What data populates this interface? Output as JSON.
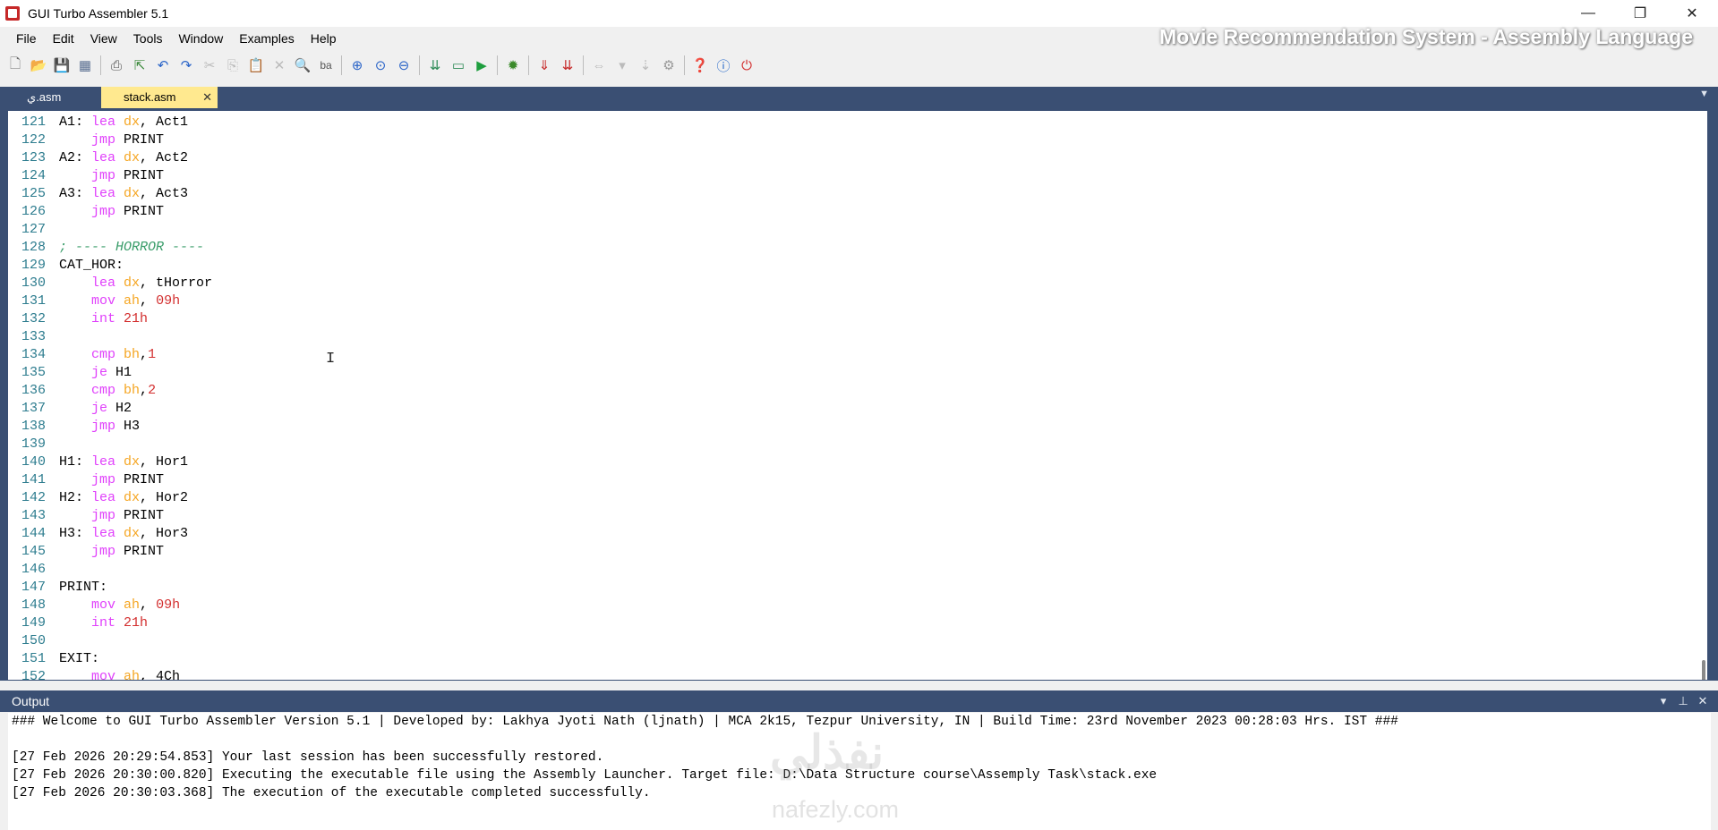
{
  "window": {
    "title": "GUI Turbo Assembler 5.1",
    "controls": {
      "minimize": "—",
      "restore": "❐",
      "close": "✕"
    }
  },
  "menu": {
    "items": [
      "File",
      "Edit",
      "View",
      "Tools",
      "Window",
      "Examples",
      "Help"
    ]
  },
  "overlay_caption": "Movie Recommendation System - Assembly Language",
  "toolbar": {
    "icons": [
      "new-file-icon",
      "open-folder-icon",
      "save-icon",
      "save-all-icon",
      "print-icon",
      "export-icon",
      "undo-icon",
      "redo-icon",
      "cut-icon",
      "copy-icon",
      "paste-icon",
      "delete-icon",
      "find-icon",
      "replace-icon",
      "zoom-in-icon",
      "zoom-reset-icon",
      "zoom-out-icon",
      "assemble-icon",
      "link-icon",
      "run-icon",
      "debug-icon",
      "download-icon",
      "settings-icon",
      "nav-back-icon",
      "filter-icon",
      "pin-icon",
      "gear-icon",
      "help-icon",
      "info-icon",
      "power-icon"
    ]
  },
  "tabs": [
    {
      "label": "ي.asm",
      "active": false
    },
    {
      "label": "stack.asm",
      "active": true,
      "close": "✕"
    }
  ],
  "editor": {
    "lines": [
      {
        "n": "121",
        "tokens": [
          [
            "plain",
            "A1: "
          ],
          [
            "kw",
            "lea "
          ],
          [
            "reg",
            "dx"
          ],
          [
            "plain",
            ", Act1"
          ]
        ]
      },
      {
        "n": "122",
        "tokens": [
          [
            "plain",
            "    "
          ],
          [
            "kw",
            "jmp "
          ],
          [
            "plain",
            "PRINT"
          ]
        ]
      },
      {
        "n": "123",
        "tokens": [
          [
            "plain",
            "A2: "
          ],
          [
            "kw",
            "lea "
          ],
          [
            "reg",
            "dx"
          ],
          [
            "plain",
            ", Act2"
          ]
        ]
      },
      {
        "n": "124",
        "tokens": [
          [
            "plain",
            "    "
          ],
          [
            "kw",
            "jmp "
          ],
          [
            "plain",
            "PRINT"
          ]
        ]
      },
      {
        "n": "125",
        "tokens": [
          [
            "plain",
            "A3: "
          ],
          [
            "kw",
            "lea "
          ],
          [
            "reg",
            "dx"
          ],
          [
            "plain",
            ", Act3"
          ]
        ]
      },
      {
        "n": "126",
        "tokens": [
          [
            "plain",
            "    "
          ],
          [
            "kw",
            "jmp "
          ],
          [
            "plain",
            "PRINT"
          ]
        ]
      },
      {
        "n": "127",
        "tokens": []
      },
      {
        "n": "128",
        "tokens": [
          [
            "cmt",
            "; ---- HORROR ----"
          ]
        ]
      },
      {
        "n": "129",
        "tokens": [
          [
            "plain",
            "CAT_HOR:"
          ]
        ]
      },
      {
        "n": "130",
        "tokens": [
          [
            "plain",
            "    "
          ],
          [
            "kw",
            "lea "
          ],
          [
            "reg",
            "dx"
          ],
          [
            "plain",
            ", tHorror"
          ]
        ]
      },
      {
        "n": "131",
        "tokens": [
          [
            "plain",
            "    "
          ],
          [
            "kw",
            "mov "
          ],
          [
            "reg",
            "ah"
          ],
          [
            "plain",
            ", "
          ],
          [
            "num",
            "09h"
          ]
        ]
      },
      {
        "n": "132",
        "tokens": [
          [
            "plain",
            "    "
          ],
          [
            "kw",
            "int "
          ],
          [
            "num",
            "21h"
          ]
        ]
      },
      {
        "n": "133",
        "tokens": []
      },
      {
        "n": "134",
        "tokens": [
          [
            "plain",
            "    "
          ],
          [
            "kw",
            "cmp "
          ],
          [
            "reg",
            "bh"
          ],
          [
            "plain",
            ","
          ],
          [
            "num",
            "1"
          ]
        ]
      },
      {
        "n": "135",
        "tokens": [
          [
            "plain",
            "    "
          ],
          [
            "kw",
            "je "
          ],
          [
            "plain",
            "H1"
          ]
        ]
      },
      {
        "n": "136",
        "tokens": [
          [
            "plain",
            "    "
          ],
          [
            "kw",
            "cmp "
          ],
          [
            "reg",
            "bh"
          ],
          [
            "plain",
            ","
          ],
          [
            "num",
            "2"
          ]
        ]
      },
      {
        "n": "137",
        "tokens": [
          [
            "plain",
            "    "
          ],
          [
            "kw",
            "je "
          ],
          [
            "plain",
            "H2"
          ]
        ]
      },
      {
        "n": "138",
        "tokens": [
          [
            "plain",
            "    "
          ],
          [
            "kw",
            "jmp "
          ],
          [
            "plain",
            "H3"
          ]
        ]
      },
      {
        "n": "139",
        "tokens": []
      },
      {
        "n": "140",
        "tokens": [
          [
            "plain",
            "H1: "
          ],
          [
            "kw",
            "lea "
          ],
          [
            "reg",
            "dx"
          ],
          [
            "plain",
            ", Hor1"
          ]
        ]
      },
      {
        "n": "141",
        "tokens": [
          [
            "plain",
            "    "
          ],
          [
            "kw",
            "jmp "
          ],
          [
            "plain",
            "PRINT"
          ]
        ]
      },
      {
        "n": "142",
        "tokens": [
          [
            "plain",
            "H2: "
          ],
          [
            "kw",
            "lea "
          ],
          [
            "reg",
            "dx"
          ],
          [
            "plain",
            ", Hor2"
          ]
        ]
      },
      {
        "n": "143",
        "tokens": [
          [
            "plain",
            "    "
          ],
          [
            "kw",
            "jmp "
          ],
          [
            "plain",
            "PRINT"
          ]
        ]
      },
      {
        "n": "144",
        "tokens": [
          [
            "plain",
            "H3: "
          ],
          [
            "kw",
            "lea "
          ],
          [
            "reg",
            "dx"
          ],
          [
            "plain",
            ", Hor3"
          ]
        ]
      },
      {
        "n": "145",
        "tokens": [
          [
            "plain",
            "    "
          ],
          [
            "kw",
            "jmp "
          ],
          [
            "plain",
            "PRINT"
          ]
        ]
      },
      {
        "n": "146",
        "tokens": []
      },
      {
        "n": "147",
        "tokens": [
          [
            "plain",
            "PRINT:"
          ]
        ]
      },
      {
        "n": "148",
        "tokens": [
          [
            "plain",
            "    "
          ],
          [
            "kw",
            "mov "
          ],
          [
            "reg",
            "ah"
          ],
          [
            "plain",
            ", "
          ],
          [
            "num",
            "09h"
          ]
        ]
      },
      {
        "n": "149",
        "tokens": [
          [
            "plain",
            "    "
          ],
          [
            "kw",
            "int "
          ],
          [
            "num",
            "21h"
          ]
        ]
      },
      {
        "n": "150",
        "tokens": []
      },
      {
        "n": "151",
        "tokens": [
          [
            "plain",
            "EXIT:"
          ]
        ]
      },
      {
        "n": "152",
        "tokens": [
          [
            "plain",
            "    "
          ],
          [
            "kw",
            "mov "
          ],
          [
            "reg",
            "ah"
          ],
          [
            "plain",
            ", 4Ch"
          ]
        ]
      }
    ]
  },
  "output": {
    "title": "Output",
    "controls": [
      "▾",
      "⊥",
      "✕"
    ],
    "lines": [
      "### Welcome to GUI Turbo Assembler Version 5.1 | Developed by: Lakhya Jyoti Nath (ljnath) | MCA 2k15, Tezpur University, IN | Build Time: 23rd November 2023 00:28:03 Hrs. IST ###",
      "",
      "[27 Feb 2026 20:29:54.853] Your last session has been successfully restored.",
      "[27 Feb 2026 20:30:00.820] Executing the executable file using the Assembly Launcher. Target file: D:\\Data Structure course\\Assemply Task\\stack.exe",
      "[27 Feb 2026 20:30:03.368] The execution of the executable completed successfully."
    ]
  },
  "watermark": {
    "text": "نفذلي",
    "sub": "nafezly.com"
  }
}
